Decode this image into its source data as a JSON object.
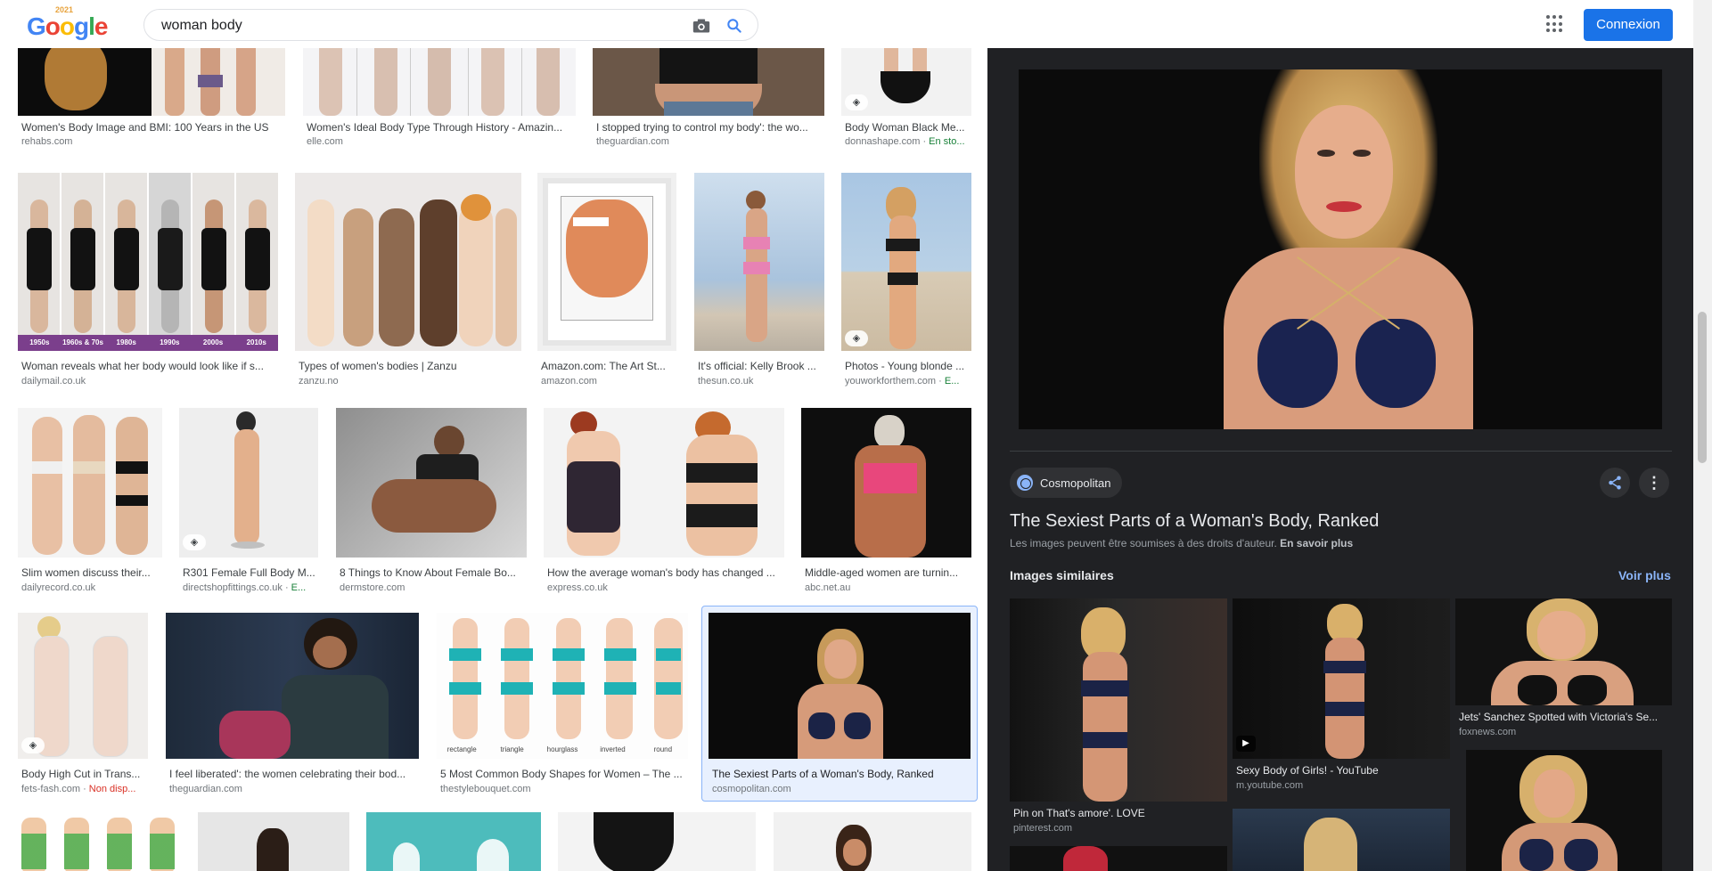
{
  "header": {
    "logo_letters": [
      "G",
      "o",
      "o",
      "g",
      "l",
      "e"
    ],
    "logo_year": "2021",
    "search_value": "woman body",
    "signin_label": "Connexion"
  },
  "results": [
    {
      "title": "Women's Body Image and BMI: 100 Years in the US",
      "source": "rehabs.com",
      "extra": ""
    },
    {
      "title": "Women's Ideal Body Type Through History - Amazin...",
      "source": "elle.com",
      "extra": ""
    },
    {
      "title": "I stopped trying to control my body': the wo...",
      "source": "theguardian.com",
      "extra": ""
    },
    {
      "title": "Body Woman Black Me...",
      "source": "donnashape.com · ",
      "extra": "En sto..."
    },
    {
      "title": "Woman reveals what her body would look like if s...",
      "source": "dailymail.co.uk",
      "extra": ""
    },
    {
      "title": "Types of women's bodies | Zanzu",
      "source": "zanzu.no",
      "extra": ""
    },
    {
      "title": "Amazon.com: The Art St...",
      "source": "amazon.com",
      "extra": ""
    },
    {
      "title": "It's official: Kelly Brook ...",
      "source": "thesun.co.uk",
      "extra": ""
    },
    {
      "title": "Photos - Young blonde ...",
      "source": "youworkforthem.com · ",
      "extra": "E..."
    },
    {
      "title": "Slim women discuss their...",
      "source": "dailyrecord.co.uk",
      "extra": ""
    },
    {
      "title": "R301 Female Full Body M...",
      "source": "directshopfittings.co.uk · ",
      "extra": "E..."
    },
    {
      "title": "8 Things to Know About Female Bo...",
      "source": "dermstore.com",
      "extra": ""
    },
    {
      "title": "How the average woman's body has changed ...",
      "source": "express.co.uk",
      "extra": ""
    },
    {
      "title": "Middle-aged women are turnin...",
      "source": "abc.net.au",
      "extra": ""
    },
    {
      "title": "Body High Cut in Trans...",
      "source": "fets-fash.com · ",
      "extra": "Non disp..."
    },
    {
      "title": "I feel liberated': the women celebrating their bod...",
      "source": "theguardian.com",
      "extra": ""
    },
    {
      "title": "5 Most Common Body Shapes for Women – The ...",
      "source": "thestylebouquet.com",
      "extra": ""
    },
    {
      "title": "The Sexiest Parts of a Woman's Body, Ranked",
      "source": "cosmopolitan.com",
      "extra": ""
    }
  ],
  "decade_labels": [
    "1950s",
    "1960s & 70s",
    "1980s",
    "1990s",
    "2000s",
    "2010s"
  ],
  "shape_labels": [
    "rectangle",
    "triangle",
    "hourglass",
    "inverted triangle",
    "round"
  ],
  "panel": {
    "site": "Cosmopolitan",
    "title": "The Sexiest Parts of a Woman's Body, Ranked",
    "copyright": "Les images peuvent être soumises à des droits d'auteur.",
    "learn_more": "En savoir plus",
    "similar_heading": "Images similaires",
    "see_more": "Voir plus",
    "similar": [
      {
        "title": "Pin on That's amore'. LOVE",
        "source": "pinterest.com"
      },
      {
        "title": "Sexy Body of Girls! - YouTube",
        "source": "m.youtube.com"
      },
      {
        "title": "Jets' Sanchez Spotted with Victoria's Se...",
        "source": "foxnews.com"
      }
    ]
  },
  "colors": {
    "accent": "#1a73e8",
    "panel_bg": "#202124",
    "link": "#8ab4f8"
  }
}
